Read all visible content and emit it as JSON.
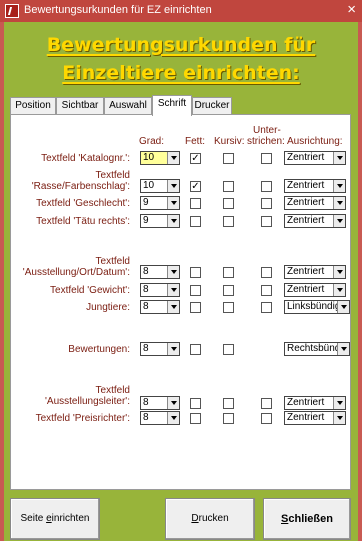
{
  "window": {
    "title": "Bewertungsurkunden für EZ einrichten",
    "close_symbol": "×"
  },
  "header": {
    "line1": "Bewertungsurkunden für",
    "line2": "Einzeltiere einrichten:"
  },
  "tabs": [
    {
      "label": "Position",
      "active": false
    },
    {
      "label": "Sichtbar",
      "active": false
    },
    {
      "label": "Auswahl",
      "active": false
    },
    {
      "label": "Schrift",
      "active": true
    },
    {
      "label": "Drucker",
      "active": false
    }
  ],
  "columns": {
    "grad": "Grad:",
    "fett": "Fett:",
    "kursiv": "Kursiv:",
    "unterstrichen_1": "Unter-",
    "unterstrichen_2": "strichen:",
    "ausrichtung": "Ausrichtung:"
  },
  "rows": [
    {
      "label1": "",
      "label2": "Textfeld 'Katalognr.':",
      "grad": "10",
      "grad_focused": true,
      "fett": true,
      "kursiv": false,
      "unterstrichen": false,
      "ausrichtung": "Zentriert"
    },
    {
      "label1": "Textfeld",
      "label2": "'Rasse/Farbenschlag':",
      "grad": "10",
      "grad_focused": false,
      "fett": true,
      "kursiv": false,
      "unterstrichen": false,
      "ausrichtung": "Zentriert"
    },
    {
      "label1": "",
      "label2": "Textfeld 'Geschlecht':",
      "grad": "9",
      "grad_focused": false,
      "fett": false,
      "kursiv": false,
      "unterstrichen": false,
      "ausrichtung": "Zentriert"
    },
    {
      "label1": "",
      "label2": "Textfeld 'Tätu rechts':",
      "grad": "9",
      "grad_focused": false,
      "fett": false,
      "kursiv": false,
      "unterstrichen": false,
      "ausrichtung": "Zentriert"
    },
    {
      "label1": "Textfeld",
      "label2": "'Ausstellung/Ort/Datum':",
      "grad": "8",
      "grad_focused": false,
      "fett": false,
      "kursiv": false,
      "unterstrichen": false,
      "ausrichtung": "Zentriert"
    },
    {
      "label1": "",
      "label2": "Textfeld 'Gewicht':",
      "grad": "8",
      "grad_focused": false,
      "fett": false,
      "kursiv": false,
      "unterstrichen": false,
      "ausrichtung": "Zentriert"
    },
    {
      "label1": "",
      "label2": "Jungtiere:",
      "grad": "8",
      "grad_focused": false,
      "fett": false,
      "kursiv": false,
      "unterstrichen": false,
      "ausrichtung": "Linksbündig"
    },
    {
      "label1": "",
      "label2": "Bewertungen:",
      "grad": "8",
      "grad_focused": false,
      "fett": false,
      "kursiv": false,
      "unterstrichen": null,
      "ausrichtung": "Rechtsbündig"
    },
    {
      "label1": "Textfeld",
      "label2": "'Ausstellungsleiter':",
      "grad": "8",
      "grad_focused": false,
      "fett": false,
      "kursiv": false,
      "unterstrichen": false,
      "ausrichtung": "Zentriert"
    },
    {
      "label1": "",
      "label2": "Textfeld 'Preisrichter':",
      "grad": "8",
      "grad_focused": false,
      "fett": false,
      "kursiv": false,
      "unterstrichen": false,
      "ausrichtung": "Zentriert"
    }
  ],
  "buttons": {
    "seite_pre": "Seite ",
    "seite_key": "e",
    "seite_post": "inrichten",
    "drucken_key": "D",
    "drucken_post": "rucken",
    "schliessen_key": "S",
    "schliessen_post": "chließen"
  },
  "icons": {
    "checkmark": "✓",
    "app": "access-form-icon",
    "dropdown": "dropdown-arrow-icon"
  },
  "colors": {
    "titlebar": "#c0463e",
    "frame": "#c85a52",
    "form_background": "#98b43a",
    "header_text": "#ffd800",
    "label_text": "#7a1c10",
    "focused_field": "#ffff9a"
  }
}
